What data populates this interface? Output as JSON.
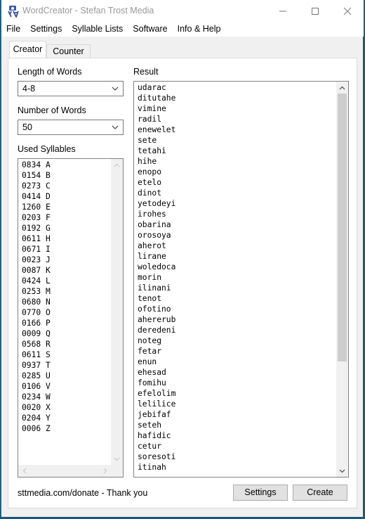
{
  "window": {
    "title": "WordCreator - Stefan Trost Media",
    "icon": "wordcreator-app-icon",
    "controls": {
      "minimize": "minimize-icon",
      "maximize": "maximize-icon",
      "close": "close-icon"
    }
  },
  "menu": {
    "items": [
      {
        "label": "File"
      },
      {
        "label": "Settings"
      },
      {
        "label": "Syllable Lists"
      },
      {
        "label": "Software"
      },
      {
        "label": "Info & Help"
      }
    ]
  },
  "tabs": [
    {
      "label": "Creator",
      "active": true
    },
    {
      "label": "Counter",
      "active": false
    }
  ],
  "creator": {
    "length_label": "Length of Words",
    "length_value": "4-8",
    "number_label": "Number of Words",
    "number_value": "50",
    "syllables_label": "Used Syllables",
    "syllables": [
      "0834 A",
      "0154 B",
      "0273 C",
      "0414 D",
      "1260 E",
      "0203 F",
      "0192 G",
      "0611 H",
      "0671 I",
      "0023 J",
      "0087 K",
      "0424 L",
      "0253 M",
      "0680 N",
      "0770 O",
      "0166 P",
      "0009 Q",
      "0568 R",
      "0611 S",
      "0937 T",
      "0285 U",
      "0106 V",
      "0234 W",
      "0020 X",
      "0204 Y",
      "0006 Z"
    ],
    "result_label": "Result",
    "results": [
      "udarac",
      "ditutahe",
      "vimine",
      "radil",
      "enewelet",
      "sete",
      "tetahi",
      "hihe",
      "enopo",
      "etelo",
      "dinot",
      "yetodeyi",
      "irohes",
      "obarina",
      "orosoya",
      "aherot",
      "lirane",
      "woledoca",
      "morin",
      "ilinani",
      "tenot",
      "ofotino",
      "ahererub",
      "deredeni",
      "noteg",
      "fetar",
      "enun",
      "ehesad",
      "fomihu",
      "efelolim",
      "lelilice",
      "jebifaf",
      "seteh",
      "hafidic",
      "cetur",
      "soresoti",
      "itinah"
    ],
    "donate_text": "sttmedia.com/donate - Thank you",
    "settings_button": "Settings",
    "create_button": "Create"
  }
}
